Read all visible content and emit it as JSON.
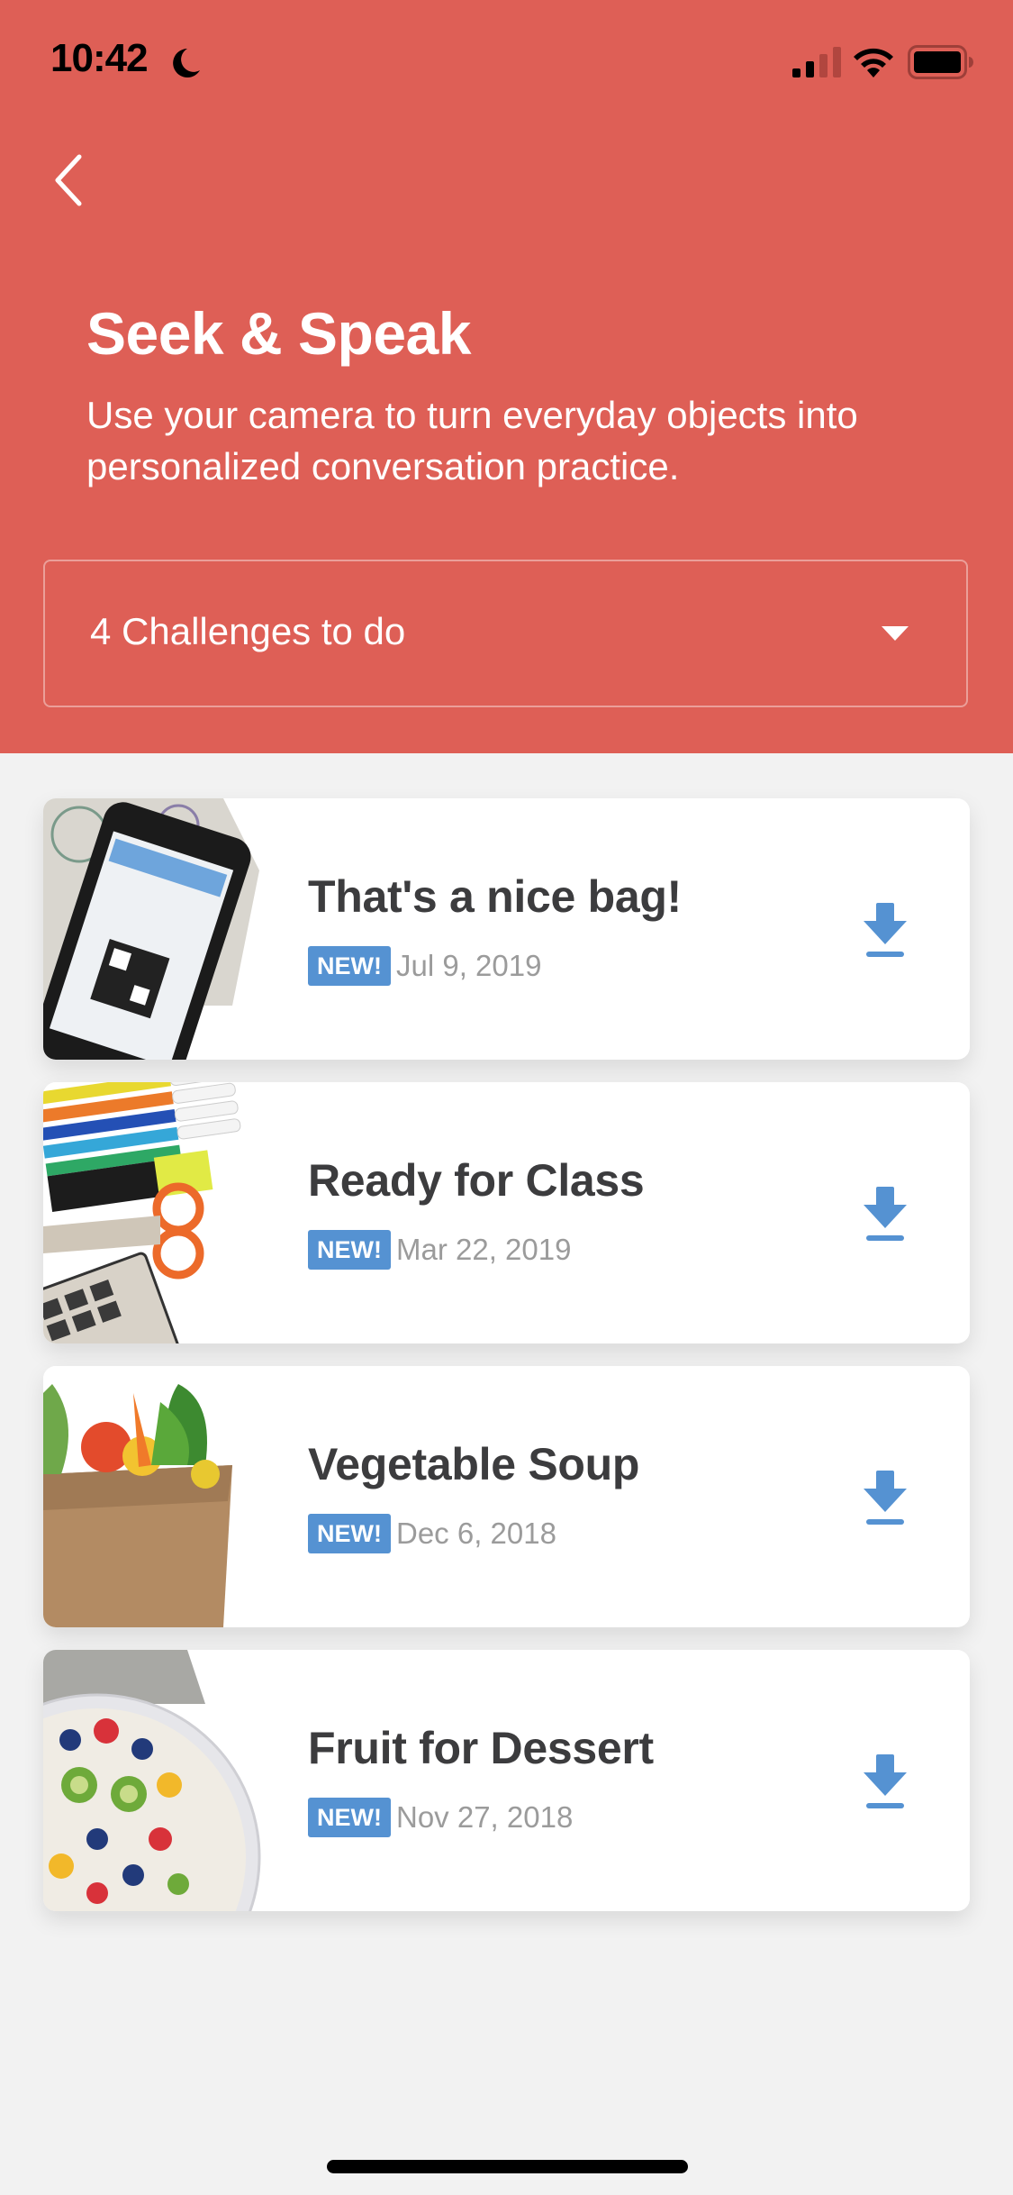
{
  "status_bar": {
    "time": "10:42",
    "icons": [
      "moon-icon",
      "cellular-signal-icon",
      "wifi-icon",
      "battery-icon"
    ]
  },
  "header": {
    "back_icon": "chevron-left-icon",
    "title": "Seek & Speak",
    "subtitle": "Use your camera to turn everyday objects into personalized conversation practice.",
    "background_color": "#de5f56"
  },
  "filter_dropdown": {
    "selected": "4 Challenges to do",
    "icon": "caret-down-icon"
  },
  "challenges": [
    {
      "title": "That's a nice bag!",
      "badge": "NEW!",
      "date": "Jul 9, 2019",
      "image": "phone-boarding-pass",
      "action_icon": "download-icon"
    },
    {
      "title": "Ready for Class",
      "badge": "NEW!",
      "date": "Mar 22, 2019",
      "image": "school-supplies",
      "action_icon": "download-icon"
    },
    {
      "title": "Vegetable Soup",
      "badge": "NEW!",
      "date": "Dec 6, 2018",
      "image": "grocery-bag-vegetables",
      "action_icon": "download-icon"
    },
    {
      "title": "Fruit for Dessert",
      "badge": "NEW!",
      "date": "Nov 27, 2018",
      "image": "fruit-bowl",
      "action_icon": "download-icon"
    }
  ],
  "colors": {
    "accent_blue": "#5592d2",
    "title_text": "#3c3c3e",
    "date_text": "#9b9b9b",
    "page_background": "#f2f2f2"
  }
}
